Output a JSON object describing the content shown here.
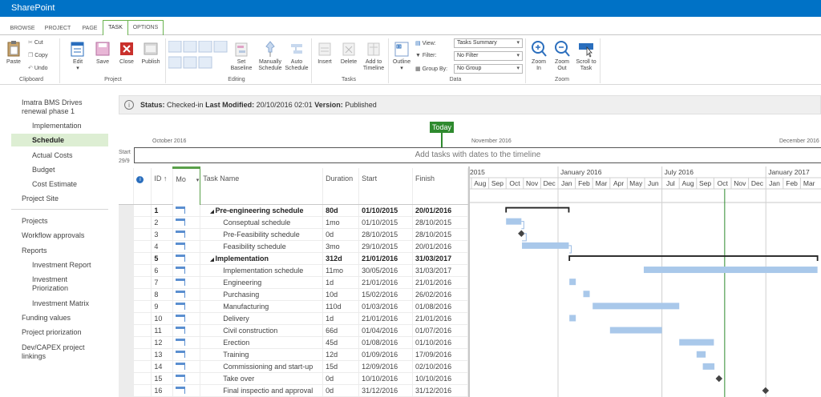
{
  "app": {
    "title": "SharePoint"
  },
  "tabs": [
    {
      "label": "BROWSE"
    },
    {
      "label": "PROJECT"
    },
    {
      "label": "PAGE"
    },
    {
      "label": "TASK"
    },
    {
      "label": "OPTIONS"
    }
  ],
  "ribbon": {
    "clipboard": {
      "paste": "Paste",
      "cut": "Cut",
      "copy": "Copy",
      "undo": "Undo",
      "group": "Clipboard"
    },
    "project": {
      "edit": "Edit",
      "save": "Save",
      "close": "Close",
      "publish": "Publish",
      "group": "Project"
    },
    "editing": {
      "set_baseline": "Set Baseline",
      "manually_schedule": "Manually Schedule",
      "auto_schedule": "Auto Schedule",
      "group": "Editing"
    },
    "tasks": {
      "insert": "Insert",
      "delete": "Delete",
      "add_to_timeline": "Add to Timeline",
      "group": "Tasks"
    },
    "data": {
      "outline": "Outline",
      "view_label": "View:",
      "view_value": "Tasks Summary",
      "filter_label": "Filter:",
      "filter_value": "No Filter",
      "groupby_label": "Group By:",
      "groupby_value": "No Group",
      "group": "Data"
    },
    "zoom": {
      "zoom_in": "Zoom In",
      "zoom_out": "Zoom Out",
      "scroll_to_task": "Scroll to Task",
      "group": "Zoom"
    }
  },
  "nav": {
    "project_name": "Imatra BMS Drives renewal phase 1",
    "sub": [
      "Implementation",
      "Schedule",
      "Actual Costs",
      "Budget",
      "Cost Estimate"
    ],
    "project_site": "Project Site",
    "items": [
      "Projects",
      "Workflow approvals",
      "Reports"
    ],
    "reports": [
      "Investment Report",
      "Investment Priorization",
      "Investment Matrix"
    ],
    "items2": [
      "Funding values",
      "Project priorization",
      "Dev/CAPEX project linkings"
    ]
  },
  "status": {
    "status_label": "Status:",
    "status_value": "Checked-in",
    "modified_label": "Last Modified:",
    "modified_value": "20/10/2016 02:01",
    "version_label": "Version:",
    "version_value": "Published"
  },
  "timeline": {
    "today": "Today",
    "start_label": "Start",
    "start_date": "29/9",
    "months": [
      "October 2016",
      "November 2016",
      "December 2016"
    ],
    "placeholder": "Add tasks with dates to the timeline"
  },
  "grid": {
    "headers": {
      "id": "ID ↑",
      "mode": "Mo",
      "name": "Task Name",
      "duration": "Duration",
      "start": "Start",
      "finish": "Finish"
    },
    "rows": [
      {
        "id": "1",
        "name": "Pre-engineering schedule",
        "duration": "80d",
        "start": "01/10/2015",
        "finish": "20/01/2016",
        "summary": true,
        "indent": 0
      },
      {
        "id": "2",
        "name": "Conseptual schedule",
        "duration": "1mo",
        "start": "01/10/2015",
        "finish": "28/10/2015",
        "summary": false,
        "indent": 1
      },
      {
        "id": "3",
        "name": "Pre-Feasibility schedule",
        "duration": "0d",
        "start": "28/10/2015",
        "finish": "28/10/2015",
        "summary": false,
        "indent": 1
      },
      {
        "id": "4",
        "name": "Feasibility schedule",
        "duration": "3mo",
        "start": "29/10/2015",
        "finish": "20/01/2016",
        "summary": false,
        "indent": 1
      },
      {
        "id": "5",
        "name": "Implementation",
        "duration": "312d",
        "start": "21/01/2016",
        "finish": "31/03/2017",
        "summary": true,
        "indent": 0
      },
      {
        "id": "6",
        "name": "Implementation schedule",
        "duration": "11mo",
        "start": "30/05/2016",
        "finish": "31/03/2017",
        "summary": false,
        "indent": 1
      },
      {
        "id": "7",
        "name": "Engineering",
        "duration": "1d",
        "start": "21/01/2016",
        "finish": "21/01/2016",
        "summary": false,
        "indent": 1
      },
      {
        "id": "8",
        "name": "Purchasing",
        "duration": "10d",
        "start": "15/02/2016",
        "finish": "26/02/2016",
        "summary": false,
        "indent": 1
      },
      {
        "id": "9",
        "name": "Manufacturing",
        "duration": "110d",
        "start": "01/03/2016",
        "finish": "01/08/2016",
        "summary": false,
        "indent": 1
      },
      {
        "id": "10",
        "name": "Delivery",
        "duration": "1d",
        "start": "21/01/2016",
        "finish": "21/01/2016",
        "summary": false,
        "indent": 1
      },
      {
        "id": "11",
        "name": "Civil construction",
        "duration": "66d",
        "start": "01/04/2016",
        "finish": "01/07/2016",
        "summary": false,
        "indent": 1
      },
      {
        "id": "12",
        "name": "Erection",
        "duration": "45d",
        "start": "01/08/2016",
        "finish": "01/10/2016",
        "summary": false,
        "indent": 1
      },
      {
        "id": "13",
        "name": "Training",
        "duration": "12d",
        "start": "01/09/2016",
        "finish": "17/09/2016",
        "summary": false,
        "indent": 1
      },
      {
        "id": "14",
        "name": "Commissioning and start-up",
        "duration": "15d",
        "start": "12/09/2016",
        "finish": "02/10/2016",
        "summary": false,
        "indent": 1
      },
      {
        "id": "15",
        "name": "Take over",
        "duration": "0d",
        "start": "10/10/2016",
        "finish": "10/10/2016",
        "summary": false,
        "indent": 1
      },
      {
        "id": "16",
        "name": "Final inspectio and approval",
        "duration": "0d",
        "start": "31/12/2016",
        "finish": "31/12/2016",
        "summary": false,
        "indent": 1
      }
    ]
  },
  "gantt": {
    "years": [
      "2015",
      "January 2016",
      "July 2016",
      "January 2017"
    ],
    "months": [
      "Aug",
      "Sep",
      "Oct",
      "Nov",
      "Dec",
      "Jan",
      "Feb",
      "Mar",
      "Apr",
      "May",
      "Jun",
      "Jul",
      "Aug",
      "Sep",
      "Oct",
      "Nov",
      "Dec",
      "Jan",
      "Feb",
      "Mar"
    ],
    "bar_color": "#a9c8ea",
    "today_color": "#2e8a2e"
  }
}
